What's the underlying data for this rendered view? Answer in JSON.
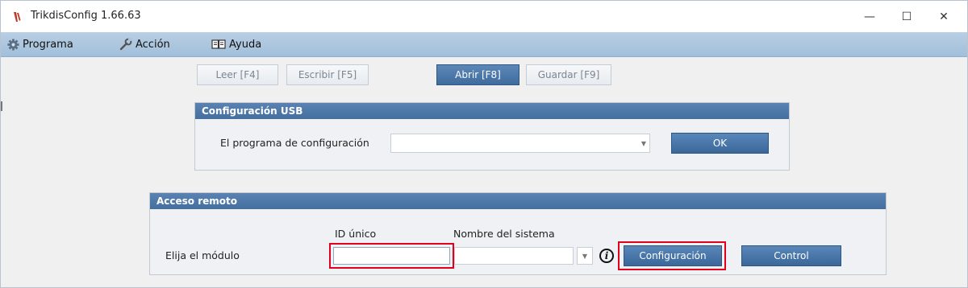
{
  "window": {
    "title": "TrikdisConfig 1.66.63",
    "controls": {
      "minimize": "—",
      "maximize": "☐",
      "close": "✕"
    }
  },
  "menu": {
    "items": [
      {
        "label": "Programa",
        "icon": "gear-icon"
      },
      {
        "label": "Acción",
        "icon": "wrench-icon"
      },
      {
        "label": "Ayuda",
        "icon": "book-icon"
      }
    ]
  },
  "toolbar": {
    "read": "Leer [F4]",
    "write": "Escribir [F5]",
    "open": "Abrir [F8]",
    "save": "Guardar [F9]"
  },
  "usb": {
    "title": "Configuración USB",
    "program_label": "El programa de configuración",
    "program_value": "",
    "ok": "OK"
  },
  "remote": {
    "title": "Acceso remoto",
    "module_label": "Elija el módulo",
    "unique_id_label": "ID único",
    "unique_id_value": "",
    "system_name_label": "Nombre del sistema",
    "system_name_value": "",
    "configuration_button": "Configuración",
    "control_button": "Control"
  },
  "colors": {
    "accent": "#446f9f",
    "highlight": "#e3001b",
    "menubar": "#a2bfda"
  }
}
